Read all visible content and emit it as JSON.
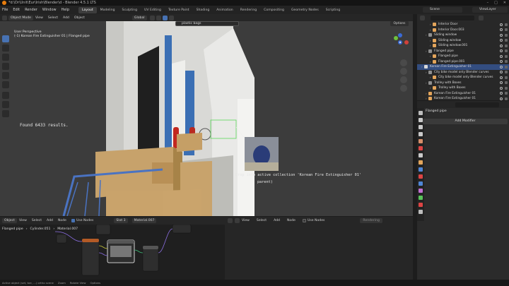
{
  "window": {
    "title": "*d:\\Dr\\Unit\\Eur\\Irish\\Blender\\d - Blender 4.5.1 LTS"
  },
  "menu": {
    "items": [
      "File",
      "Edit",
      "Render",
      "Window",
      "Help"
    ],
    "workspaces": [
      "Layout",
      "Modeling",
      "Sculpting",
      "UV Editing",
      "Texture Paint",
      "Shading",
      "Animation",
      "Rendering",
      "Compositing",
      "Geometry Nodes",
      "Scripting"
    ],
    "active_workspace": "Layout",
    "scene": "Scene",
    "view_layer": "ViewLayer"
  },
  "viewport_header": {
    "mode": "Object Mode",
    "menus": [
      "View",
      "Select",
      "Add",
      "Object"
    ],
    "orientation": "Global"
  },
  "viewport": {
    "view_name": "User Perspective",
    "object_info": "(-1) Korean Fire Extinguisher 01 | Flanged pipe",
    "search_value": "plastic bags",
    "options_label": "Options",
    "found_text": "Found 6433 results.",
    "drop_text": "Drop into active collection 'Korean Fire Extinguisher 01'",
    "drop_sub": "parent)"
  },
  "node_editor": {
    "header": {
      "type": "Object",
      "menus": [
        "View",
        "Select",
        "Add",
        "Node"
      ],
      "use_nodes": "Use Nodes",
      "slot": "Slot 3",
      "material": "Material.007"
    },
    "breadcrumb": [
      "Flanged pipe",
      "Cylinder.051",
      "Material.007"
    ]
  },
  "image_editor": {
    "menus": [
      "View",
      "Select",
      "Add",
      "Node"
    ],
    "use_nodes": "Use Nodes",
    "field": "Rendering"
  },
  "outliner": {
    "rows": [
      {
        "label": "Interior Door",
        "indent": 2,
        "color": "#e3a55b",
        "selected": false
      },
      {
        "label": "Interior Door.003",
        "indent": 2,
        "color": "#e3a55b",
        "selected": false
      },
      {
        "label": "Sliding window",
        "indent": 1,
        "color": "#8f8f8f",
        "selected": false
      },
      {
        "label": "Sliding window",
        "indent": 2,
        "color": "#e3a55b",
        "selected": false
      },
      {
        "label": "Sliding window.001",
        "indent": 2,
        "color": "#e3a55b",
        "selected": false
      },
      {
        "label": "Flanged pipe",
        "indent": 1,
        "color": "#8f8f8f",
        "selected": false
      },
      {
        "label": "Flanged pipe",
        "indent": 2,
        "color": "#e3a55b",
        "selected": false
      },
      {
        "label": "Flanged pipe.001",
        "indent": 2,
        "color": "#e3a55b",
        "selected": false
      },
      {
        "label": "Korean Fire Extinguisher 01",
        "indent": 0,
        "color": "#d8d8d8",
        "selected": true
      },
      {
        "label": "City bike model only Blender curves",
        "indent": 1,
        "color": "#8f8f8f",
        "selected": false
      },
      {
        "label": "City bike model only Blender curves",
        "indent": 2,
        "color": "#e3a55b",
        "selected": false
      },
      {
        "label": "Trolley with Boxes",
        "indent": 1,
        "color": "#8f8f8f",
        "selected": false
      },
      {
        "label": "Trolley with Boxes",
        "indent": 2,
        "color": "#e3a55b",
        "selected": false
      },
      {
        "label": "Korean Fire Extinguisher 01",
        "indent": 1,
        "color": "#e3a55b",
        "selected": false
      },
      {
        "label": "Korean Fire Extinguisher 01",
        "indent": 1,
        "color": "#e3a55b",
        "selected": false
      }
    ]
  },
  "properties": {
    "object_name": "Flanged pipe",
    "add_modifier": "Add Modifier"
  },
  "statusbar": {
    "items": [
      "Active object (set, toe, ...) ortho scene",
      "Zoom",
      "Rotate View",
      "Options"
    ]
  },
  "colors": {
    "accent": "#4772b3",
    "brand": "#e87d0d"
  }
}
